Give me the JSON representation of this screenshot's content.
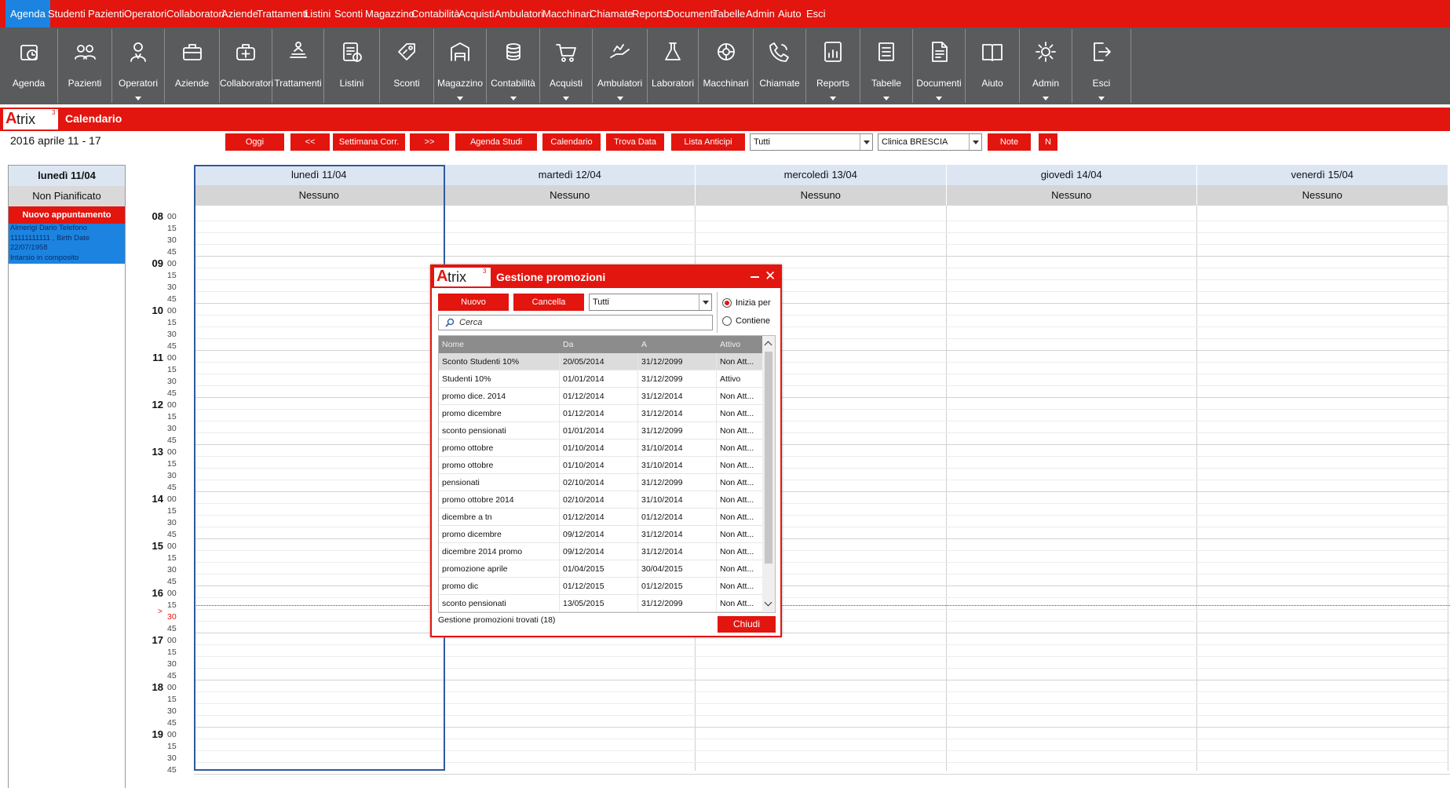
{
  "menu": [
    {
      "label": "Agenda",
      "active": true,
      "caret": false
    },
    {
      "label": "Studenti",
      "caret": true
    },
    {
      "label": "Pazienti",
      "caret": false
    },
    {
      "label": "Operatori",
      "caret": true
    },
    {
      "label": "Collaboratori",
      "caret": false
    },
    {
      "label": "Aziende",
      "caret": false
    },
    {
      "label": "Trattamenti",
      "caret": false
    },
    {
      "label": "Listini",
      "caret": false
    },
    {
      "label": "Sconti",
      "caret": false
    },
    {
      "label": "Magazzino",
      "caret": true
    },
    {
      "label": "Contabilità",
      "caret": true
    },
    {
      "label": "Acquisti",
      "caret": true
    },
    {
      "label": "Ambulatori",
      "caret": true
    },
    {
      "label": "Macchinari",
      "caret": false
    },
    {
      "label": "Chiamate",
      "caret": false
    },
    {
      "label": "Reports",
      "caret": true
    },
    {
      "label": "Documenti",
      "caret": true
    },
    {
      "label": "Tabelle",
      "caret": true
    },
    {
      "label": "Admin",
      "caret": true
    },
    {
      "label": "Aiuto",
      "caret": false
    },
    {
      "label": "Esci",
      "caret": true
    }
  ],
  "toolbar": [
    {
      "label": "Agenda",
      "icon": "agenda-icon",
      "dropdown": false
    },
    {
      "label": "Pazienti",
      "icon": "users-icon",
      "dropdown": false
    },
    {
      "label": "Operatori",
      "icon": "operator-icon",
      "dropdown": true
    },
    {
      "label": "Aziende",
      "icon": "briefcase-icon",
      "dropdown": false
    },
    {
      "label": "Collaboratori",
      "icon": "medical-bag-icon",
      "dropdown": false
    },
    {
      "label": "Trattamenti",
      "icon": "massage-icon",
      "dropdown": false
    },
    {
      "label": "Listini",
      "icon": "price-list-icon",
      "dropdown": false
    },
    {
      "label": "Sconti",
      "icon": "discount-tag-icon",
      "dropdown": false
    },
    {
      "label": "Magazzino",
      "icon": "warehouse-icon",
      "dropdown": true
    },
    {
      "label": "Contabilità",
      "icon": "coins-icon",
      "dropdown": true
    },
    {
      "label": "Acquisti",
      "icon": "cart-icon",
      "dropdown": true
    },
    {
      "label": "Ambulatori",
      "icon": "hand-care-icon",
      "dropdown": true
    },
    {
      "label": "Laboratori",
      "icon": "flask-icon",
      "dropdown": false
    },
    {
      "label": "Macchinari",
      "icon": "machine-icon",
      "dropdown": false
    },
    {
      "label": "Chiamate",
      "icon": "phone-icon",
      "dropdown": false
    },
    {
      "label": "Reports",
      "icon": "report-icon",
      "dropdown": true
    },
    {
      "label": "Tabelle",
      "icon": "table-icon",
      "dropdown": true
    },
    {
      "label": "Documenti",
      "icon": "document-icon",
      "dropdown": true
    },
    {
      "label": "Aiuto",
      "icon": "help-book-icon",
      "dropdown": false
    },
    {
      "label": "Admin",
      "icon": "admin-gear-icon",
      "dropdown": true
    },
    {
      "label": "Esci",
      "icon": "exit-icon",
      "dropdown": true
    }
  ],
  "app": {
    "logo_prefix": "A",
    "logo_rest": "trix",
    "logo_sup": "3",
    "title": "Calendario"
  },
  "week_range": "2016 aprile 11 - 17",
  "actions": {
    "oggi": "Oggi",
    "prev": "<<",
    "current_week": "Settimana Corr.",
    "next": ">>",
    "agenda_studi": "Agenda Studi",
    "calendario": "Calendario",
    "trova_data": "Trova Data",
    "lista_anticipi": "Lista Anticipi",
    "filter_value": "Tutti",
    "clinic_value": "Clinica BRESCIA",
    "note": "Note",
    "n": "N"
  },
  "left_panel": {
    "day": "lunedì 11/04",
    "unplanned": "Non Pianificato",
    "new_appointment": "Nuovo appuntamento",
    "appointment_lines": [
      "Almerigi Dario   Telefono",
      "11111111111 , Birth Date",
      "22/07/1958",
      "Intarsio in composito"
    ]
  },
  "days": [
    {
      "header": "lunedì 11/04",
      "sub": "Nessuno"
    },
    {
      "header": "martedì 12/04",
      "sub": "Nessuno"
    },
    {
      "header": "mercoledì 13/04",
      "sub": "Nessuno"
    },
    {
      "header": "giovedì 14/04",
      "sub": "Nessuno"
    },
    {
      "header": "venerdì 15/04",
      "sub": "Nessuno"
    }
  ],
  "hours": [
    "08",
    "09",
    "10",
    "11",
    "12",
    "13",
    "14",
    "15",
    "16",
    "17",
    "18",
    "19"
  ],
  "minutes": [
    "00",
    "15",
    "30",
    "45"
  ],
  "current_time_marker": "16:30",
  "dialog": {
    "title": "Gestione promozioni",
    "new_button": "Nuovo",
    "cancel_button": "Cancella",
    "filter_value": "Tutti",
    "search_placeholder": "Cerca",
    "radio_starts": "Inizia per",
    "radio_contains": "Contiene",
    "radio_selected": "starts",
    "columns": [
      "Nome",
      "Da",
      "A",
      "Attivo"
    ],
    "rows": [
      [
        "Sconto Studenti 10%",
        "20/05/2014",
        "31/12/2099",
        "Non Att..."
      ],
      [
        "Studenti 10%",
        "01/01/2014",
        "31/12/2099",
        "Attivo"
      ],
      [
        "promo dice. 2014",
        "01/12/2014",
        "31/12/2014",
        "Non Att..."
      ],
      [
        "promo dicembre",
        "01/12/2014",
        "31/12/2014",
        "Non Att..."
      ],
      [
        "sconto pensionati",
        "01/01/2014",
        "31/12/2099",
        "Non Att..."
      ],
      [
        "promo ottobre",
        "01/10/2014",
        "31/10/2014",
        "Non Att..."
      ],
      [
        "promo ottobre",
        "01/10/2014",
        "31/10/2014",
        "Non Att..."
      ],
      [
        "pensionati",
        "02/10/2014",
        "31/12/2099",
        "Non Att..."
      ],
      [
        "promo ottobre 2014",
        "02/10/2014",
        "31/10/2014",
        "Non Att..."
      ],
      [
        "dicembre a tn",
        "01/12/2014",
        "01/12/2014",
        "Non Att..."
      ],
      [
        "promo dicembre",
        "09/12/2014",
        "31/12/2014",
        "Non Att..."
      ],
      [
        "dicembre 2014 promo",
        "09/12/2014",
        "31/12/2014",
        "Non Att..."
      ],
      [
        "promozione aprile",
        "01/04/2015",
        "30/04/2015",
        "Non Att..."
      ],
      [
        "promo dic",
        "01/12/2015",
        "01/12/2015",
        "Non Att..."
      ],
      [
        "sconto pensionati",
        "13/05/2015",
        "31/12/2099",
        "Non Att..."
      ]
    ],
    "found_text": "Gestione promozioni trovati (18)",
    "close_button": "Chiudi"
  }
}
